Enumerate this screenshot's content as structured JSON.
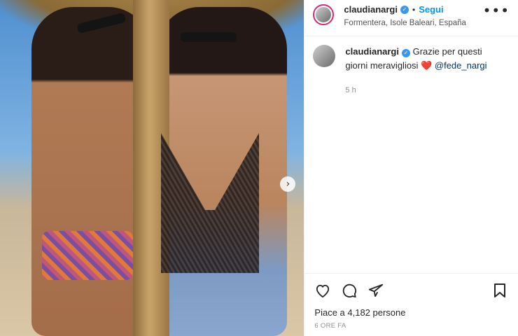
{
  "post": {
    "username": "claudianargi",
    "follow_label": "Segui",
    "location": "Formentera, Isole Baleari, España",
    "more_label": "•••",
    "caption": {
      "username": "claudianargi",
      "text": "Grazie per questi giorni meravigliosi",
      "emoji": "❤️",
      "mention": "@fede_nargi",
      "time": "5 h"
    },
    "likes_text": "Piace a 4,182 persone",
    "time_ago": "6 ORE FA",
    "icons": [
      "heart-icon",
      "comment-icon",
      "share-icon",
      "bookmark-icon",
      "chevron-right-icon",
      "verified-badge-icon"
    ]
  }
}
